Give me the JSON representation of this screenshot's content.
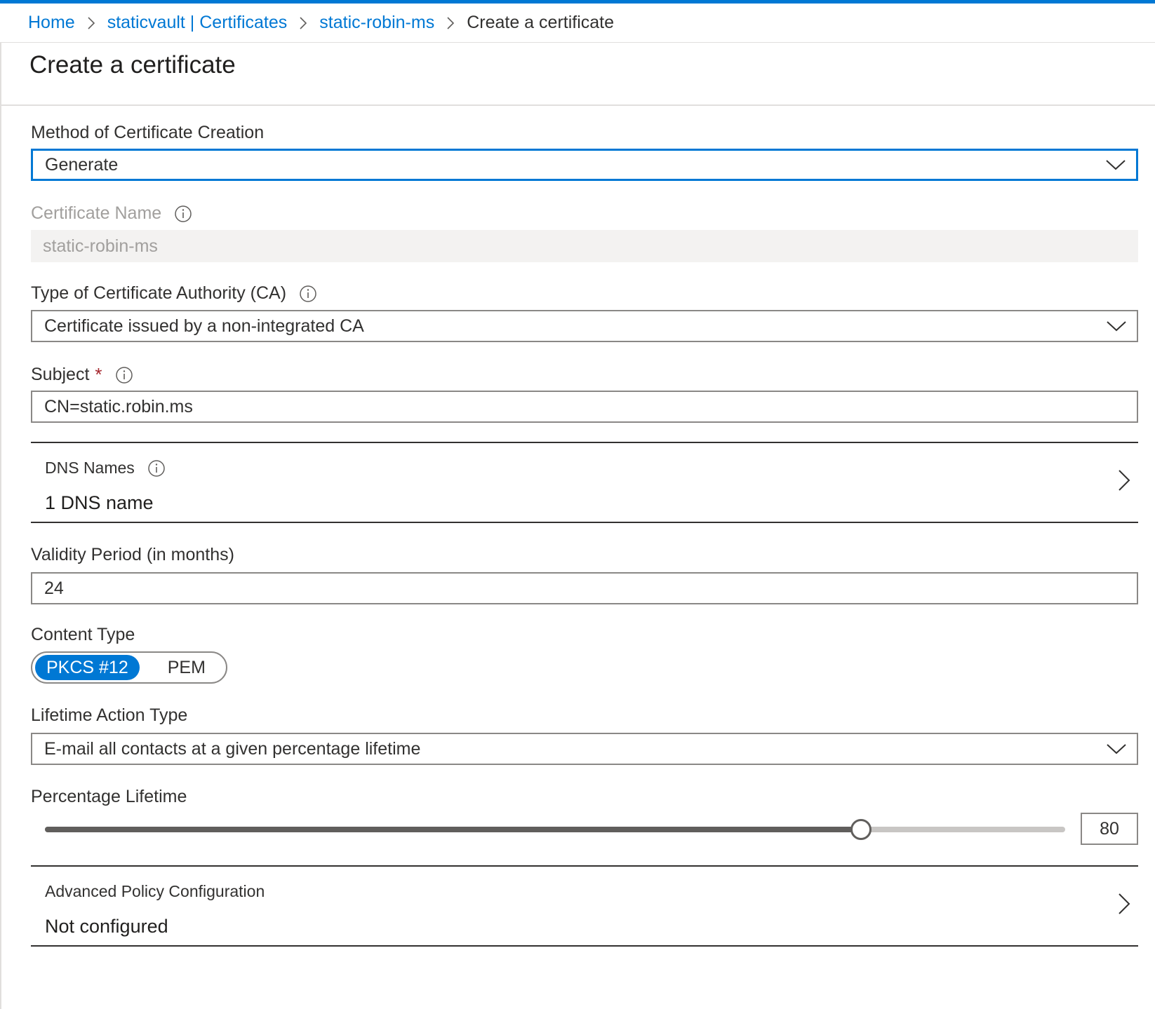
{
  "breadcrumb": {
    "items": [
      {
        "label": "Home"
      },
      {
        "label": "staticvault | Certificates"
      },
      {
        "label": "static-robin-ms"
      },
      {
        "label": "Create a certificate"
      }
    ]
  },
  "page": {
    "title": "Create a certificate"
  },
  "form": {
    "method": {
      "label": "Method of Certificate Creation",
      "value": "Generate"
    },
    "cert_name": {
      "label": "Certificate Name",
      "value": "static-robin-ms"
    },
    "ca_type": {
      "label": "Type of Certificate Authority (CA)",
      "value": "Certificate issued by a non-integrated CA"
    },
    "subject": {
      "label": "Subject",
      "required_mark": "*",
      "value": "CN=static.robin.ms"
    },
    "dns": {
      "title": "DNS Names",
      "value": "1 DNS name"
    },
    "validity": {
      "label": "Validity Period (in months)",
      "value": "24"
    },
    "content_type": {
      "label": "Content Type",
      "options": [
        "PKCS #12",
        "PEM"
      ],
      "selected": "PKCS #12"
    },
    "lifetime_action": {
      "label": "Lifetime Action Type",
      "value": "E-mail all contacts at a given percentage lifetime"
    },
    "percentage": {
      "label": "Percentage Lifetime",
      "value": "80",
      "fraction": 0.8
    },
    "advanced": {
      "title": "Advanced Policy Configuration",
      "value": "Not configured"
    }
  },
  "colors": {
    "accent": "#0078d4",
    "required": "#a4262c",
    "disabled_text": "#a19f9d"
  },
  "icons": [
    "chevron-right-icon",
    "chevron-down-icon",
    "info-icon"
  ]
}
